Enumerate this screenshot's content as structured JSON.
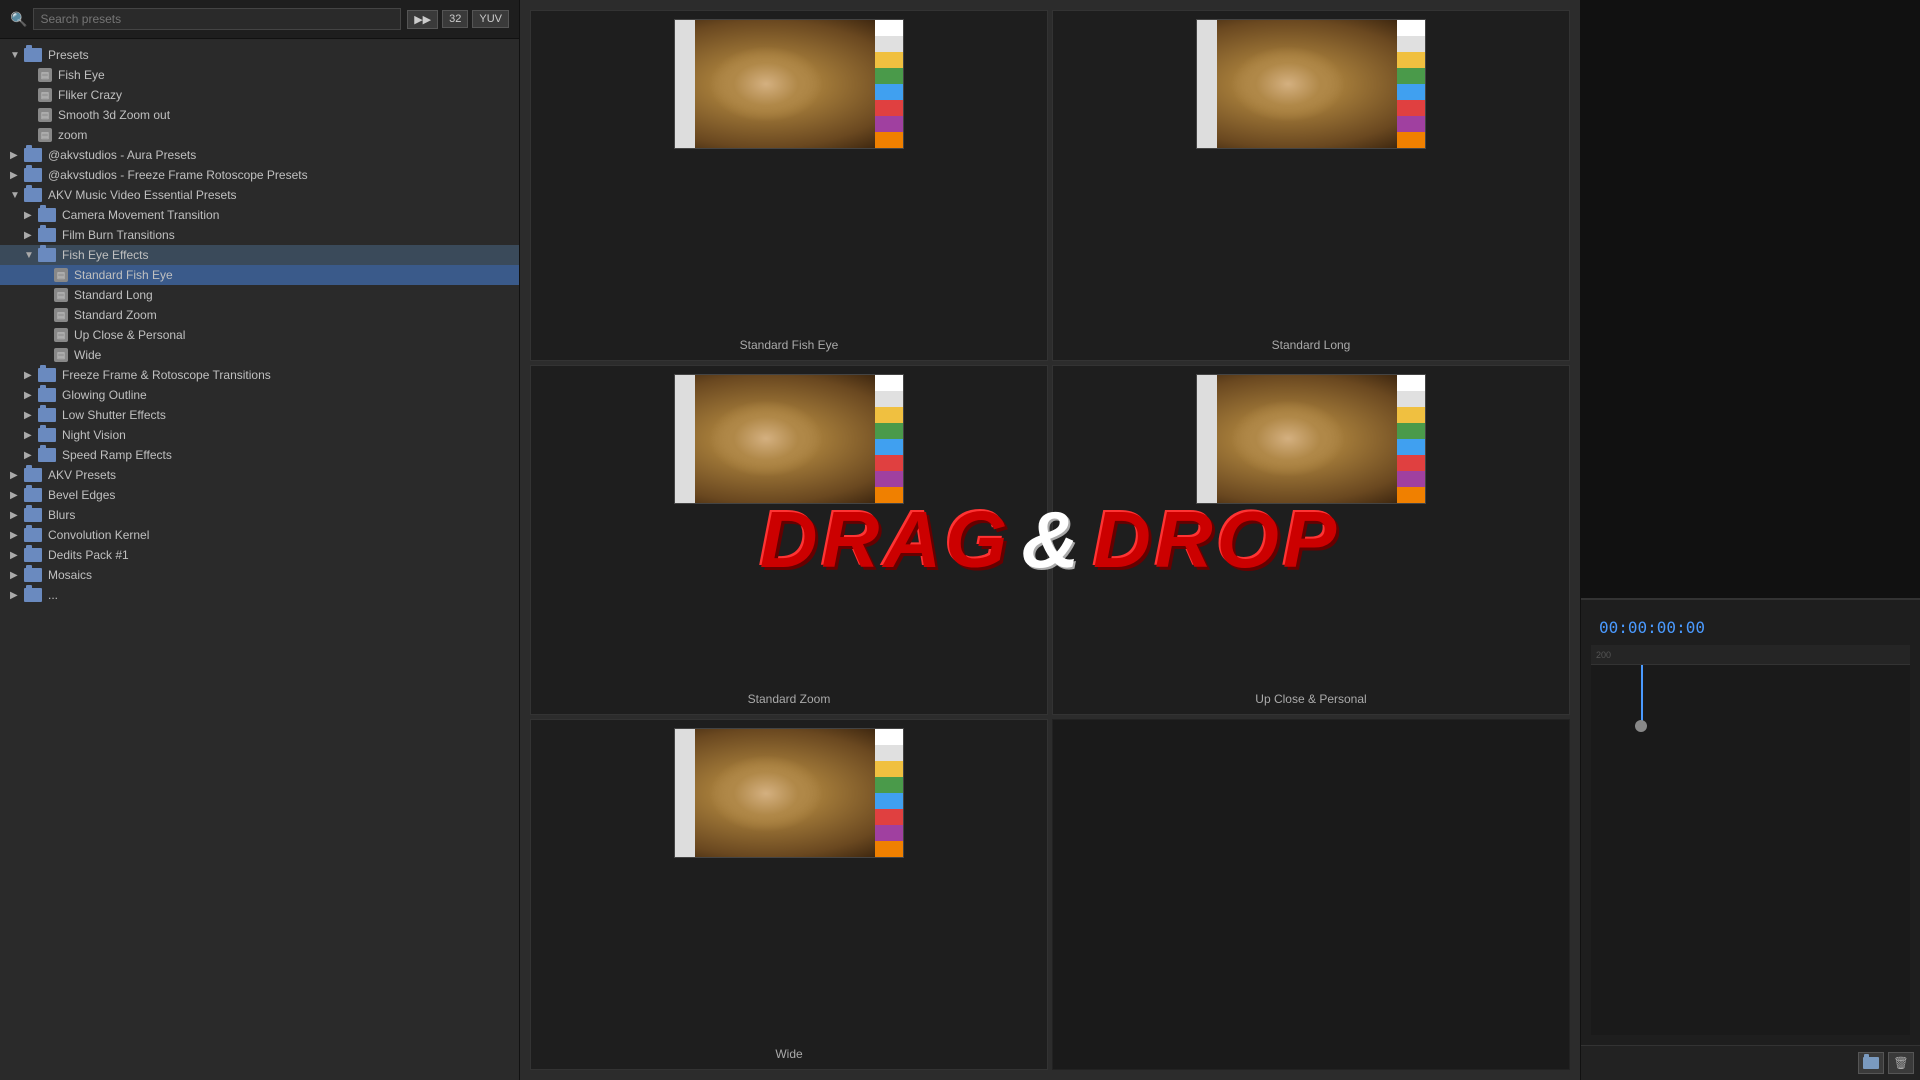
{
  "search": {
    "placeholder": "Search presets",
    "toolbar": {
      "btn1": "▶▶",
      "btn2": "32",
      "btn3": "YUV"
    }
  },
  "tree": {
    "items": [
      {
        "id": "presets-root",
        "label": "Presets",
        "type": "folder",
        "expanded": true,
        "indent": 0,
        "arrow": "▼"
      },
      {
        "id": "fish-eye",
        "label": "Fish Eye",
        "type": "preset",
        "indent": 1
      },
      {
        "id": "fliker-crazy",
        "label": "Fliker Crazy",
        "type": "preset",
        "indent": 1
      },
      {
        "id": "smooth-3d-zoom",
        "label": "Smooth 3d Zoom out",
        "type": "preset",
        "indent": 1
      },
      {
        "id": "zoom",
        "label": "zoom",
        "type": "preset",
        "indent": 1
      },
      {
        "id": "akvstudios-aura",
        "label": "@akvstudios - Aura Presets",
        "type": "folder",
        "indent": 0,
        "arrow": "▶"
      },
      {
        "id": "akvstudios-freeze",
        "label": "@akvstudios - Freeze Frame Rotoscope Presets",
        "type": "folder",
        "indent": 0,
        "arrow": "▶"
      },
      {
        "id": "akv-music-video",
        "label": "AKV Music Video Essential Presets",
        "type": "folder",
        "expanded": true,
        "indent": 0,
        "arrow": "▼"
      },
      {
        "id": "camera-movement",
        "label": "Camera Movement Transition",
        "type": "folder",
        "indent": 1,
        "arrow": "▶"
      },
      {
        "id": "film-burn",
        "label": "Film Burn Transitions",
        "type": "folder",
        "indent": 1,
        "arrow": "▶"
      },
      {
        "id": "fish-eye-effects",
        "label": "Fish Eye Effects",
        "type": "folder",
        "expanded": true,
        "indent": 1,
        "arrow": "▼"
      },
      {
        "id": "standard-fish-eye",
        "label": "Standard Fish Eye",
        "type": "preset",
        "indent": 2,
        "selected": true
      },
      {
        "id": "standard-long",
        "label": "Standard Long",
        "type": "preset",
        "indent": 2
      },
      {
        "id": "standard-zoom",
        "label": "Standard Zoom",
        "type": "preset",
        "indent": 2
      },
      {
        "id": "up-close-personal",
        "label": "Up Close & Personal",
        "type": "preset",
        "indent": 2
      },
      {
        "id": "wide",
        "label": "Wide",
        "type": "preset",
        "indent": 2
      },
      {
        "id": "freeze-frame",
        "label": "Freeze Frame & Rotoscope Transitions",
        "type": "folder",
        "indent": 1,
        "arrow": "▶"
      },
      {
        "id": "glowing-outline",
        "label": "Glowing Outline",
        "type": "folder",
        "indent": 1,
        "arrow": "▶"
      },
      {
        "id": "low-shutter",
        "label": "Low Shutter Effects",
        "type": "folder",
        "indent": 1,
        "arrow": "▶"
      },
      {
        "id": "night-vision",
        "label": "Night Vision",
        "type": "folder",
        "indent": 1,
        "arrow": "▶"
      },
      {
        "id": "speed-ramp",
        "label": "Speed Ramp Effects",
        "type": "folder",
        "indent": 1,
        "arrow": "▶"
      },
      {
        "id": "akv-presets",
        "label": "AKV Presets",
        "type": "folder",
        "indent": 0,
        "arrow": "▶"
      },
      {
        "id": "bevel-edges",
        "label": "Bevel Edges",
        "type": "folder",
        "indent": 0,
        "arrow": "▶"
      },
      {
        "id": "blurs",
        "label": "Blurs",
        "type": "folder",
        "indent": 0,
        "arrow": "▶"
      },
      {
        "id": "convolution-kernel",
        "label": "Convolution Kernel",
        "type": "folder",
        "indent": 0,
        "arrow": "▶"
      },
      {
        "id": "dedits-pack1",
        "label": "Dedits Pack #1",
        "type": "folder",
        "indent": 0,
        "arrow": "▶"
      },
      {
        "id": "mosaics",
        "label": "Mosaics",
        "type": "folder",
        "indent": 0,
        "arrow": "▶"
      }
    ]
  },
  "previews": [
    {
      "id": "standard-fish-eye",
      "label": "Standard Fish Eye"
    },
    {
      "id": "standard-long",
      "label": "Standard Long"
    },
    {
      "id": "standard-zoom",
      "label": "Standard Zoom"
    },
    {
      "id": "up-close-personal",
      "label": "Up Close & Personal"
    },
    {
      "id": "wide",
      "label": "Wide"
    },
    {
      "id": "empty",
      "label": ""
    }
  ],
  "drag_drop": {
    "text1": "DRAG",
    "amp": "&",
    "text2": "DROP"
  },
  "timecode": {
    "value": "00:00:00:00"
  },
  "bottom_toolbar": {
    "folder_btn": "📁",
    "delete_btn": "🗑"
  }
}
